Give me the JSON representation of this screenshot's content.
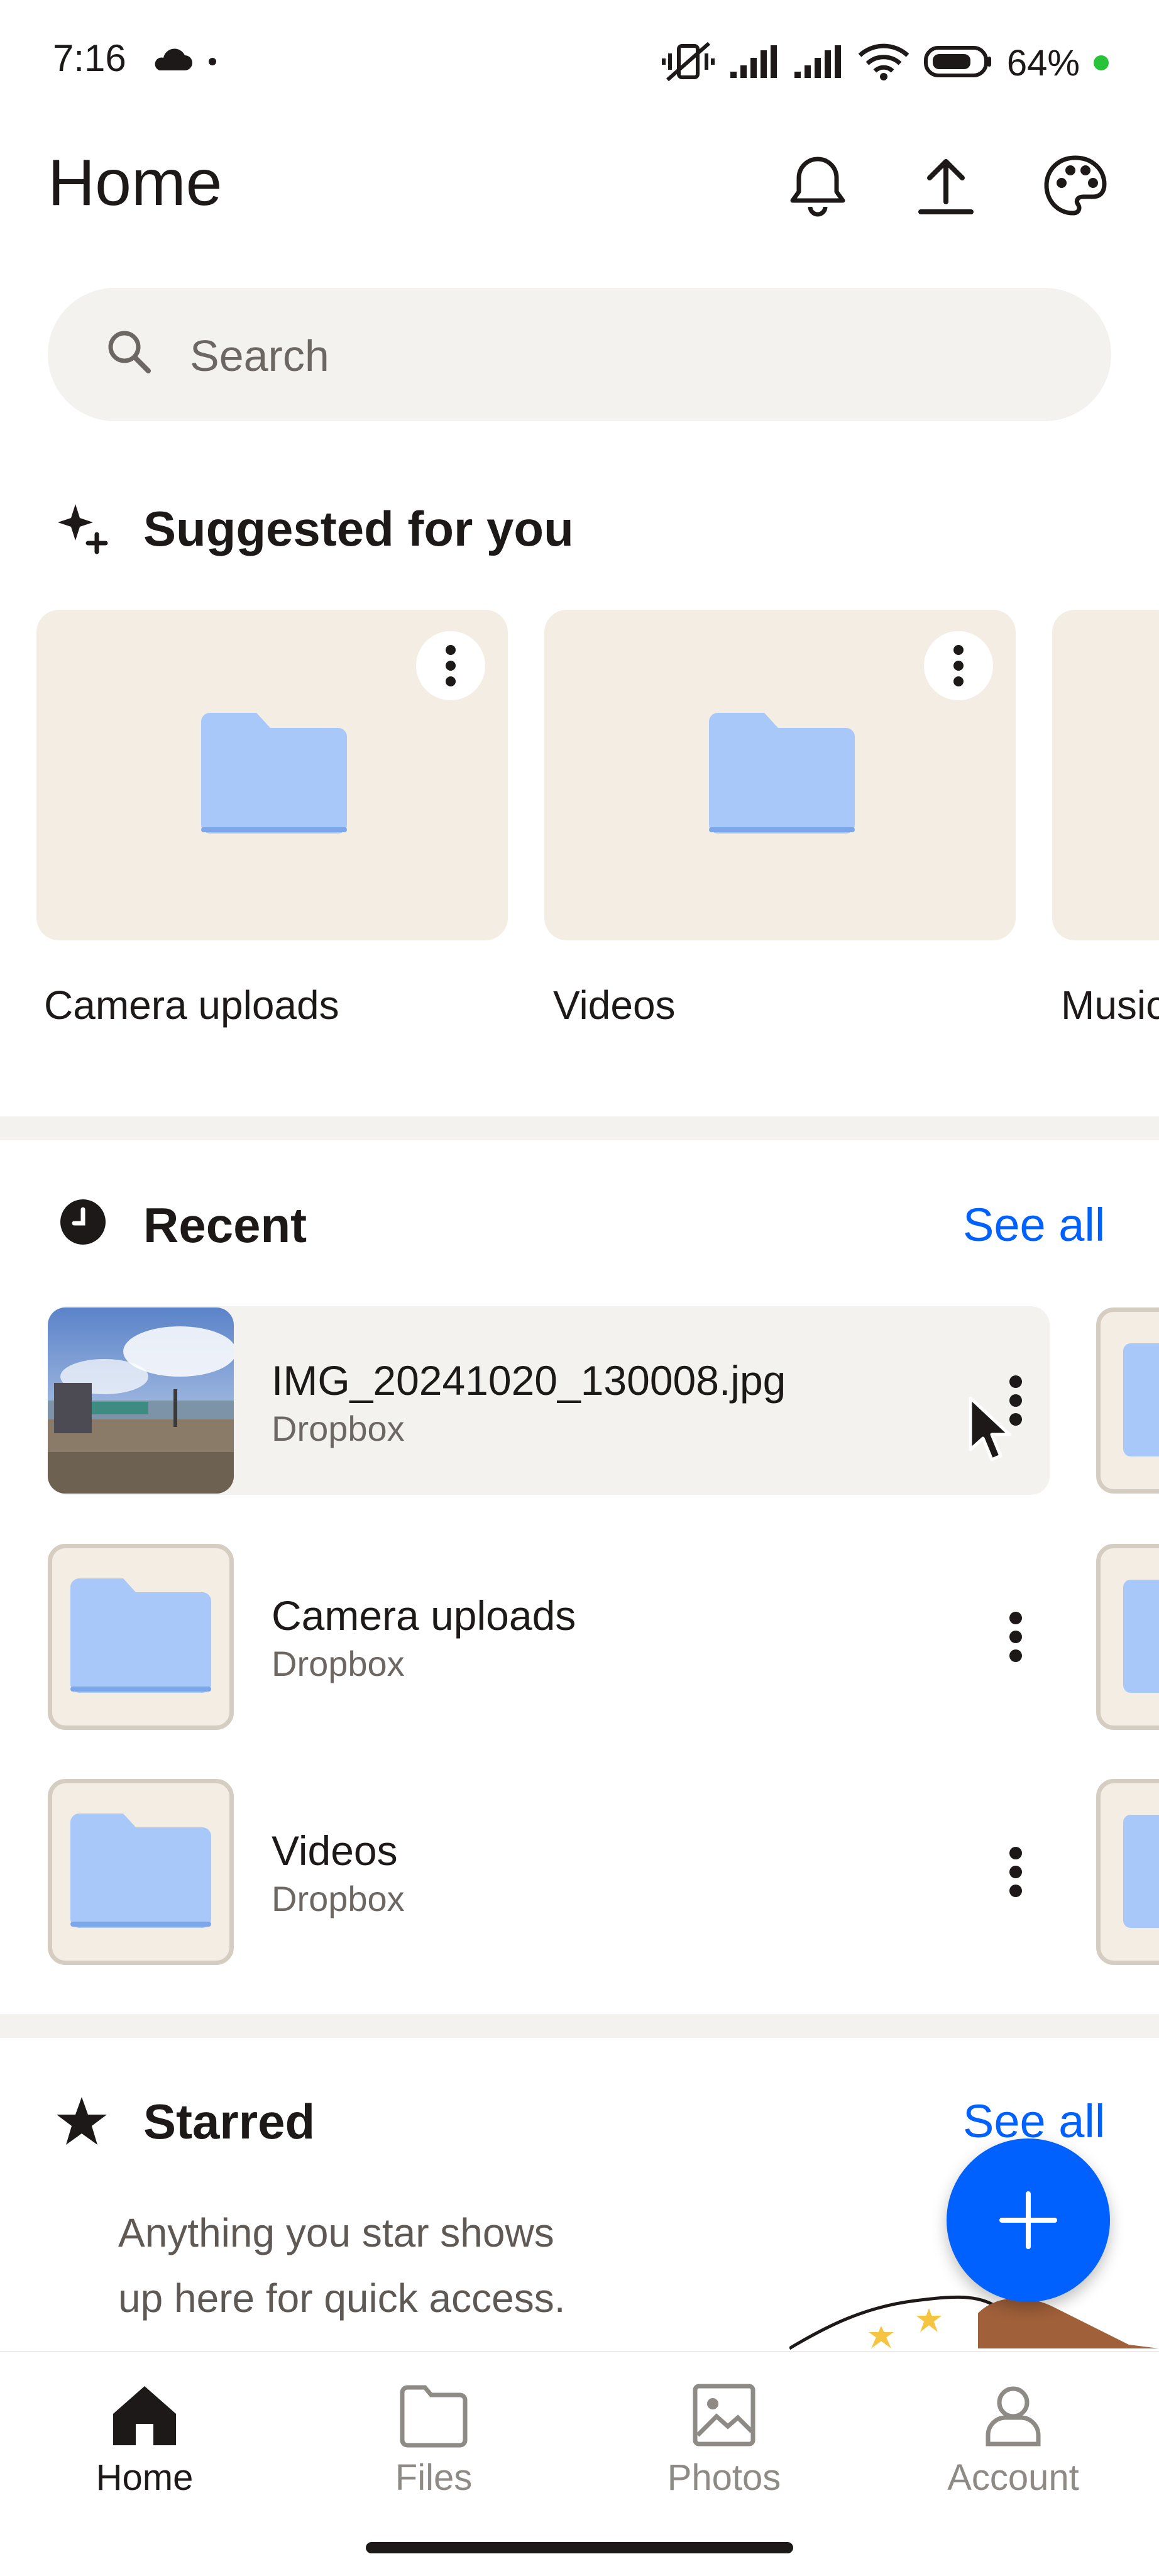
{
  "status_bar": {
    "time": "7:16",
    "battery": "64%"
  },
  "header": {
    "title": "Home"
  },
  "search": {
    "placeholder": "Search"
  },
  "suggested": {
    "title": "Suggested for you",
    "items": [
      {
        "label": "Camera uploads"
      },
      {
        "label": "Videos"
      },
      {
        "label": "Music"
      }
    ]
  },
  "recent": {
    "title": "Recent",
    "see_all": "See all",
    "items": [
      {
        "name": "IMG_20241020_130008.jpg",
        "location": "Dropbox"
      },
      {
        "name": "Camera uploads",
        "location": "Dropbox"
      },
      {
        "name": "Videos",
        "location": "Dropbox"
      }
    ]
  },
  "starred": {
    "title": "Starred",
    "see_all": "See all",
    "empty_line1": "Anything you star shows",
    "empty_line2": "up here for quick access."
  },
  "nav": {
    "items": [
      {
        "label": "Home",
        "icon": "home-icon"
      },
      {
        "label": "Files",
        "icon": "folder-icon"
      },
      {
        "label": "Photos",
        "icon": "photo-icon"
      },
      {
        "label": "Account",
        "icon": "account-icon"
      }
    ]
  },
  "colors": {
    "accent": "#0061fe",
    "folder": "#a8c8fa",
    "card_bg": "#f4ede4"
  }
}
